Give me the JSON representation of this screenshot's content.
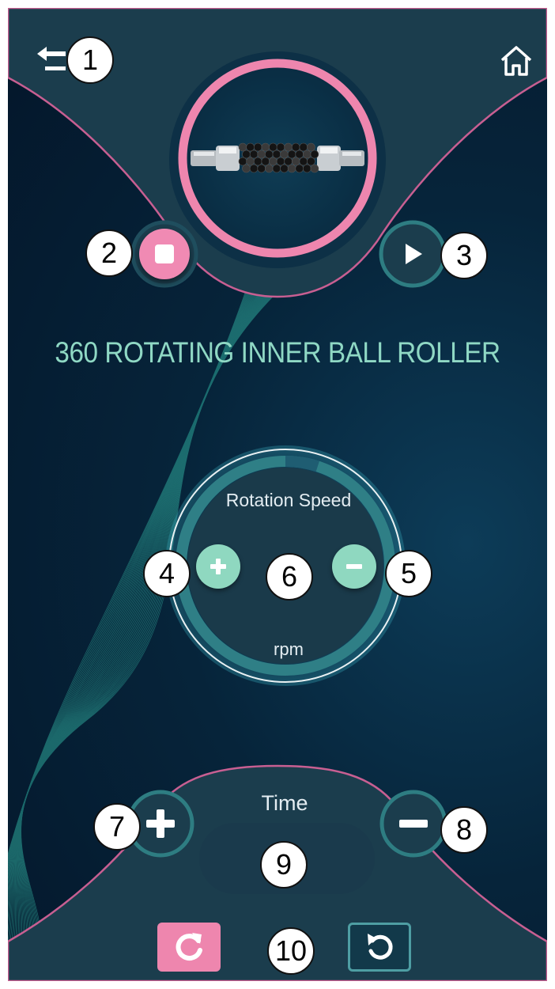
{
  "header": {
    "back_icon": "back-arrow-icon",
    "home_icon": "home-icon"
  },
  "product": {
    "title": "360 ROTATING INNER BALL ROLLER",
    "image_icon": "ball-roller-image"
  },
  "controls": {
    "stop_icon": "stop-icon",
    "play_icon": "play-icon"
  },
  "speed": {
    "label": "Rotation Speed",
    "unit": "rpm",
    "value": "",
    "increase_icon": "plus-icon",
    "decrease_icon": "minus-icon",
    "dial_level": 0.05
  },
  "time": {
    "label": "Time",
    "value": "",
    "increase_icon": "plus-icon",
    "decrease_icon": "minus-icon"
  },
  "footer": {
    "reset_icon": "refresh-icon",
    "undo_icon": "undo-icon"
  },
  "callouts": [
    "1",
    "2",
    "3",
    "4",
    "5",
    "6",
    "7",
    "8",
    "9",
    "10"
  ],
  "colors": {
    "accent_pink": "#ee86ae",
    "accent_teal": "#8fd8c4",
    "panel": "#1b3d4d",
    "background": "#04162a"
  }
}
